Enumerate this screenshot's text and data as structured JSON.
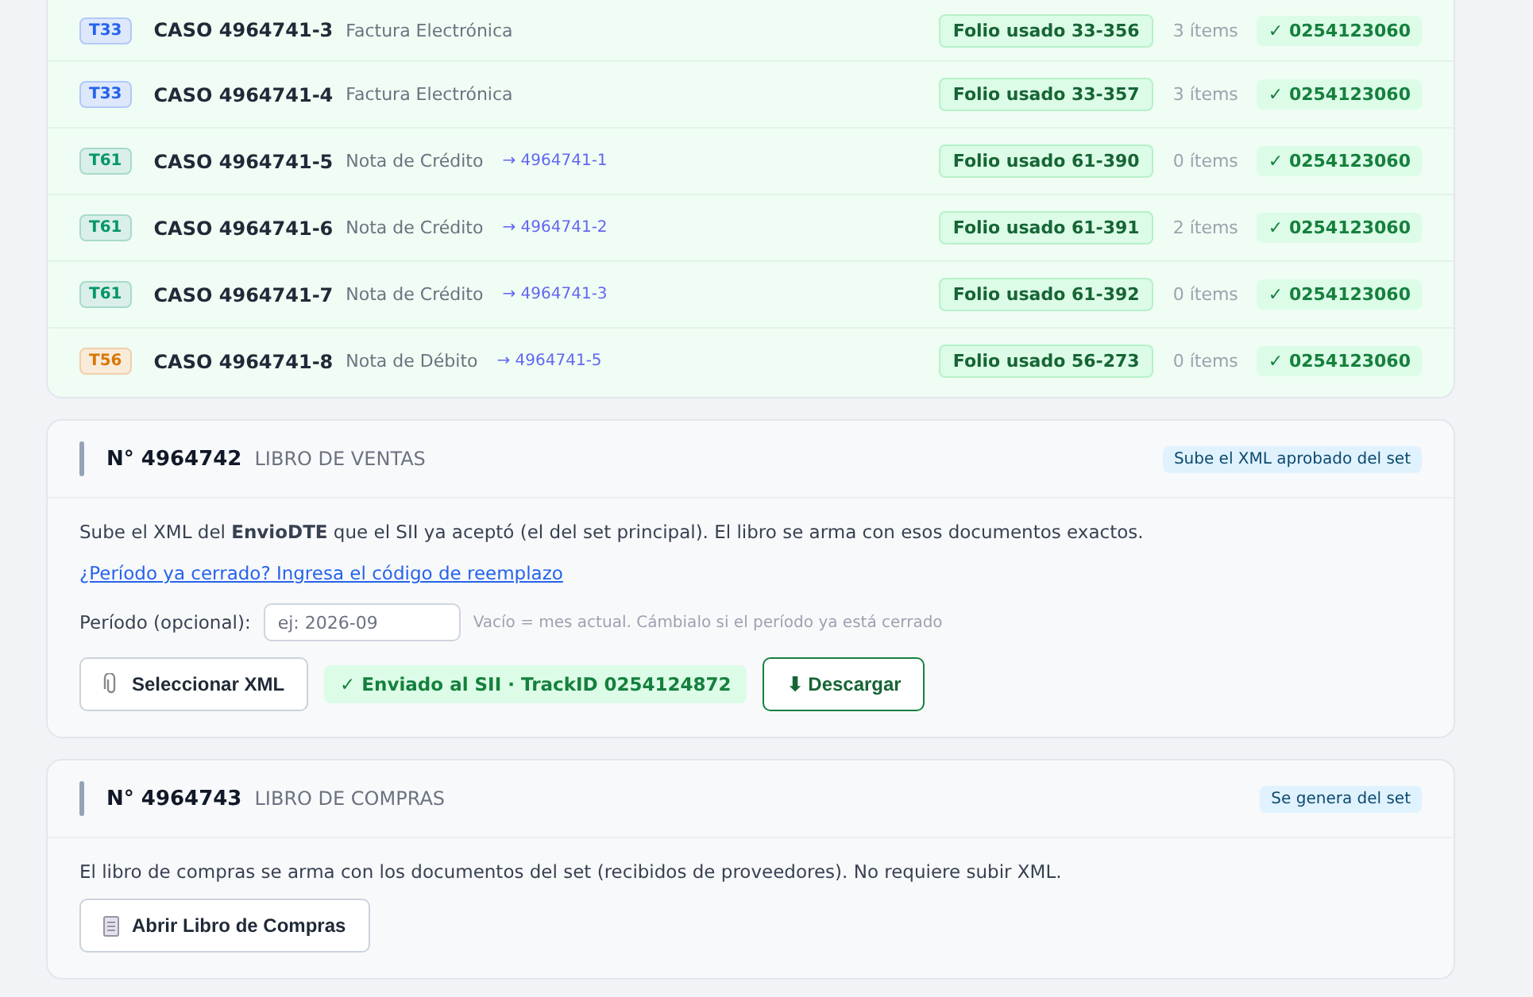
{
  "cases": [
    {
      "type": "T33",
      "color": "#2563eb",
      "title": "CASO 4964741-3",
      "doc": "Factura Electrónica",
      "folio": "Folio usado 33-356",
      "items": "3 ítems",
      "track": "✓ 0254123060"
    },
    {
      "type": "T33",
      "color": "#2563eb",
      "title": "CASO 4964741-4",
      "doc": "Factura Electrónica",
      "folio": "Folio usado 33-357",
      "items": "3 ítems",
      "track": "✓ 0254123060"
    },
    {
      "type": "T61",
      "color": "#059669",
      "title": "CASO 4964741-5",
      "doc": "Nota de Crédito",
      "ref": "→ 4964741-1",
      "folio": "Folio usado 61-390",
      "items": "0 ítems",
      "track": "✓ 0254123060"
    },
    {
      "type": "T61",
      "color": "#059669",
      "title": "CASO 4964741-6",
      "doc": "Nota de Crédito",
      "ref": "→ 4964741-2",
      "folio": "Folio usado 61-391",
      "items": "2 ítems",
      "track": "✓ 0254123060"
    },
    {
      "type": "T61",
      "color": "#059669",
      "title": "CASO 4964741-7",
      "doc": "Nota de Crédito",
      "ref": "→ 4964741-3",
      "folio": "Folio usado 61-392",
      "items": "0 ítems",
      "track": "✓ 0254123060"
    },
    {
      "type": "T56",
      "color": "#d97706",
      "title": "CASO 4964741-8",
      "doc": "Nota de Débito",
      "ref": "→ 4964741-5",
      "folio": "Folio usado 56-273",
      "items": "0 ítems",
      "track": "✓ 0254123060"
    }
  ],
  "ventas": {
    "number": "N° 4964742",
    "title": "LIBRO DE VENTAS",
    "tag": "Sube el XML aprobado del set",
    "text": "Sube el XML del **EnvioDTE** que el SII ya aceptó (el del set principal). El libro se arma con esos documentos exactos.",
    "link": "¿Período ya cerrado? Ingresa el código de reemplazo",
    "period_label": "Período (opcional):",
    "period_placeholder": "ej: 2026-09",
    "period_hint": "Vacío = mes actual. Cámbialo si el período ya está cerrado",
    "select_button": "Seleccionar XML",
    "status": "✓ Enviado al SII · TrackID 0254124872",
    "download_button": "⬇ Descargar"
  },
  "compras": {
    "number": "N° 4964743",
    "title": "LIBRO DE COMPRAS",
    "tag": "Se genera del set",
    "text": "El libro de compras se arma con los documentos del set (recibidos de proveedores). No requiere subir XML.",
    "open_button": "Abrir Libro de Compras"
  }
}
